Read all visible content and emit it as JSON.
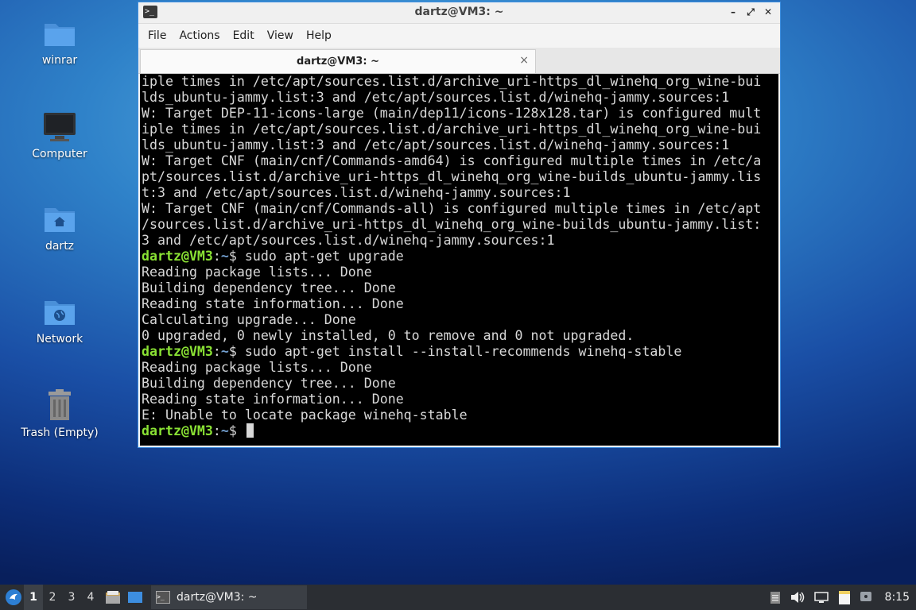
{
  "desktop": {
    "icons": [
      {
        "label": "winrar",
        "icon": "folder-icon"
      },
      {
        "label": "Computer",
        "icon": "computer-icon"
      },
      {
        "label": "dartz",
        "icon": "home-folder-icon"
      },
      {
        "label": "Network",
        "icon": "network-folder-icon"
      },
      {
        "label": "Trash (Empty)",
        "icon": "trash-icon"
      }
    ]
  },
  "window": {
    "title": "dartz@VM3: ~",
    "menu": [
      "File",
      "Actions",
      "Edit",
      "View",
      "Help"
    ],
    "tab_label": "dartz@VM3: ~",
    "tab_close": "×",
    "accent_color": "#3d8ee0"
  },
  "terminal": {
    "colors": {
      "background": "#000000",
      "text": "#d8d8d8",
      "prompt_user": "#8ae234",
      "prompt_path": "#729fcf"
    },
    "lines": [
      {
        "text": "iple times in /etc/apt/sources.list.d/archive_uri-https_dl_winehq_org_wine-bui"
      },
      {
        "text": "lds_ubuntu-jammy.list:3 and /etc/apt/sources.list.d/winehq-jammy.sources:1"
      },
      {
        "text": "W: Target DEP-11-icons-large (main/dep11/icons-128x128.tar) is configured mult"
      },
      {
        "text": "iple times in /etc/apt/sources.list.d/archive_uri-https_dl_winehq_org_wine-bui"
      },
      {
        "text": "lds_ubuntu-jammy.list:3 and /etc/apt/sources.list.d/winehq-jammy.sources:1"
      },
      {
        "text": "W: Target CNF (main/cnf/Commands-amd64) is configured multiple times in /etc/a"
      },
      {
        "text": "pt/sources.list.d/archive_uri-https_dl_winehq_org_wine-builds_ubuntu-jammy.lis"
      },
      {
        "text": "t:3 and /etc/apt/sources.list.d/winehq-jammy.sources:1"
      },
      {
        "text": "W: Target CNF (main/cnf/Commands-all) is configured multiple times in /etc/apt"
      },
      {
        "text": "/sources.list.d/archive_uri-https_dl_winehq_org_wine-builds_ubuntu-jammy.list:"
      },
      {
        "text": "3 and /etc/apt/sources.list.d/winehq-jammy.sources:1"
      },
      {
        "prompt_user": "dartz@VM3",
        "prompt_sep": ":",
        "prompt_path": "~",
        "prompt_end": "$ ",
        "text": "sudo apt-get upgrade"
      },
      {
        "text": "Reading package lists... Done"
      },
      {
        "text": "Building dependency tree... Done"
      },
      {
        "text": "Reading state information... Done"
      },
      {
        "text": "Calculating upgrade... Done"
      },
      {
        "text": "0 upgraded, 0 newly installed, 0 to remove and 0 not upgraded."
      },
      {
        "prompt_user": "dartz@VM3",
        "prompt_sep": ":",
        "prompt_path": "~",
        "prompt_end": "$ ",
        "text": "sudo apt-get install --install-recommends winehq-stable"
      },
      {
        "text": "Reading package lists... Done"
      },
      {
        "text": "Building dependency tree... Done"
      },
      {
        "text": "Reading state information... Done"
      },
      {
        "text": "E: Unable to locate package winehq-stable"
      },
      {
        "prompt_user": "dartz@VM3",
        "prompt_sep": ":",
        "prompt_path": "~",
        "prompt_end": "$ ",
        "text": "",
        "cursor": true
      }
    ]
  },
  "taskbar": {
    "workspaces": [
      "1",
      "2",
      "3",
      "4"
    ],
    "active_workspace": "1",
    "task_label": "dartz@VM3: ~",
    "clock": "8:15"
  }
}
